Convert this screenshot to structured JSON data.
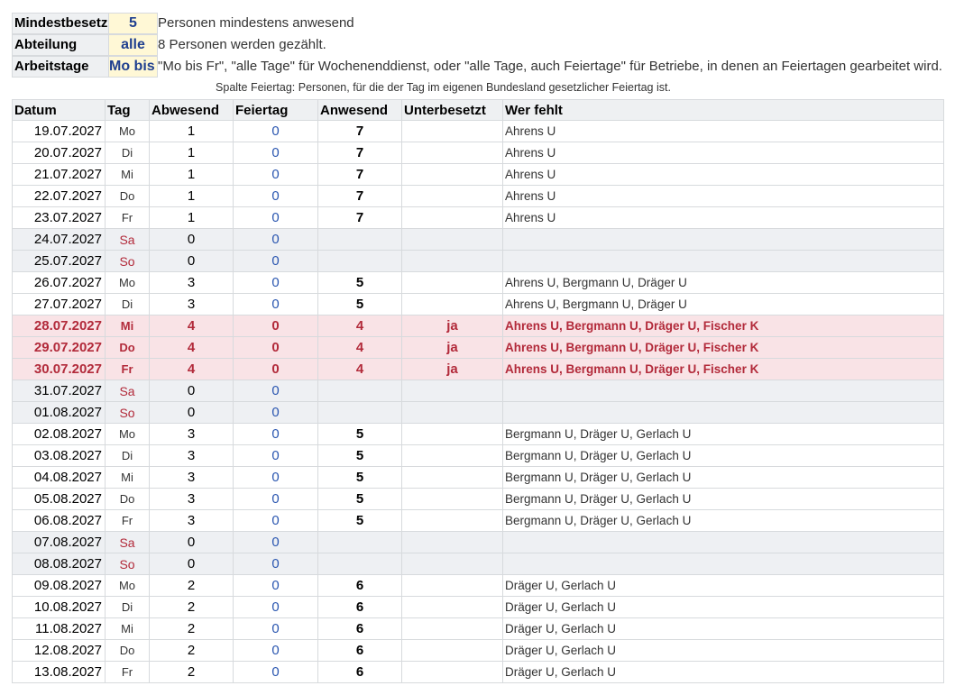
{
  "settings": [
    {
      "label": "Mindestbesetzung",
      "value": "5",
      "description": "Personen mindestens anwesend"
    },
    {
      "label": "Abteilung",
      "value": "alle",
      "description": "8 Personen werden gezählt."
    },
    {
      "label": "Arbeitstage",
      "value": "Mo bis Fr",
      "description": "\"Mo bis Fr\", \"alle Tage\" für Wochenenddienst, oder \"alle Tage, auch Feiertage\" für Betriebe, in denen an Feiertagen gearbeitet wird."
    }
  ],
  "note": "Spalte Feiertag: Personen, für die der Tag im eigenen Bundesland gesetzlicher Feiertag ist.",
  "columns": [
    "Datum",
    "Tag",
    "Abwesend",
    "Feiertag",
    "Anwesend",
    "Unterbesetzt",
    "Wer fehlt"
  ],
  "rows": [
    {
      "datum": "19.07.2027",
      "tag": "Mo",
      "abwesend": "1",
      "feiertag": "0",
      "anwesend": "7",
      "unterbesetzt": "",
      "wer_fehlt": "Ahrens U",
      "status": "normal"
    },
    {
      "datum": "20.07.2027",
      "tag": "Di",
      "abwesend": "1",
      "feiertag": "0",
      "anwesend": "7",
      "unterbesetzt": "",
      "wer_fehlt": "Ahrens U",
      "status": "normal"
    },
    {
      "datum": "21.07.2027",
      "tag": "Mi",
      "abwesend": "1",
      "feiertag": "0",
      "anwesend": "7",
      "unterbesetzt": "",
      "wer_fehlt": "Ahrens U",
      "status": "normal"
    },
    {
      "datum": "22.07.2027",
      "tag": "Do",
      "abwesend": "1",
      "feiertag": "0",
      "anwesend": "7",
      "unterbesetzt": "",
      "wer_fehlt": "Ahrens U",
      "status": "normal"
    },
    {
      "datum": "23.07.2027",
      "tag": "Fr",
      "abwesend": "1",
      "feiertag": "0",
      "anwesend": "7",
      "unterbesetzt": "",
      "wer_fehlt": "Ahrens U",
      "status": "normal"
    },
    {
      "datum": "24.07.2027",
      "tag": "Sa",
      "abwesend": "0",
      "feiertag": "0",
      "anwesend": "",
      "unterbesetzt": "",
      "wer_fehlt": "",
      "status": "weekend"
    },
    {
      "datum": "25.07.2027",
      "tag": "So",
      "abwesend": "0",
      "feiertag": "0",
      "anwesend": "",
      "unterbesetzt": "",
      "wer_fehlt": "",
      "status": "weekend"
    },
    {
      "datum": "26.07.2027",
      "tag": "Mo",
      "abwesend": "3",
      "feiertag": "0",
      "anwesend": "5",
      "unterbesetzt": "",
      "wer_fehlt": "Ahrens U, Bergmann U, Dräger U",
      "status": "normal"
    },
    {
      "datum": "27.07.2027",
      "tag": "Di",
      "abwesend": "3",
      "feiertag": "0",
      "anwesend": "5",
      "unterbesetzt": "",
      "wer_fehlt": "Ahrens U, Bergmann U, Dräger U",
      "status": "normal"
    },
    {
      "datum": "28.07.2027",
      "tag": "Mi",
      "abwesend": "4",
      "feiertag": "0",
      "anwesend": "4",
      "unterbesetzt": "ja",
      "wer_fehlt": "Ahrens U, Bergmann U, Dräger U, Fischer K",
      "status": "under"
    },
    {
      "datum": "29.07.2027",
      "tag": "Do",
      "abwesend": "4",
      "feiertag": "0",
      "anwesend": "4",
      "unterbesetzt": "ja",
      "wer_fehlt": "Ahrens U, Bergmann U, Dräger U, Fischer K",
      "status": "under"
    },
    {
      "datum": "30.07.2027",
      "tag": "Fr",
      "abwesend": "4",
      "feiertag": "0",
      "anwesend": "4",
      "unterbesetzt": "ja",
      "wer_fehlt": "Ahrens U, Bergmann U, Dräger U, Fischer K",
      "status": "under"
    },
    {
      "datum": "31.07.2027",
      "tag": "Sa",
      "abwesend": "0",
      "feiertag": "0",
      "anwesend": "",
      "unterbesetzt": "",
      "wer_fehlt": "",
      "status": "weekend"
    },
    {
      "datum": "01.08.2027",
      "tag": "So",
      "abwesend": "0",
      "feiertag": "0",
      "anwesend": "",
      "unterbesetzt": "",
      "wer_fehlt": "",
      "status": "weekend"
    },
    {
      "datum": "02.08.2027",
      "tag": "Mo",
      "abwesend": "3",
      "feiertag": "0",
      "anwesend": "5",
      "unterbesetzt": "",
      "wer_fehlt": "Bergmann U, Dräger U, Gerlach U",
      "status": "normal"
    },
    {
      "datum": "03.08.2027",
      "tag": "Di",
      "abwesend": "3",
      "feiertag": "0",
      "anwesend": "5",
      "unterbesetzt": "",
      "wer_fehlt": "Bergmann U, Dräger U, Gerlach U",
      "status": "normal"
    },
    {
      "datum": "04.08.2027",
      "tag": "Mi",
      "abwesend": "3",
      "feiertag": "0",
      "anwesend": "5",
      "unterbesetzt": "",
      "wer_fehlt": "Bergmann U, Dräger U, Gerlach U",
      "status": "normal"
    },
    {
      "datum": "05.08.2027",
      "tag": "Do",
      "abwesend": "3",
      "feiertag": "0",
      "anwesend": "5",
      "unterbesetzt": "",
      "wer_fehlt": "Bergmann U, Dräger U, Gerlach U",
      "status": "normal"
    },
    {
      "datum": "06.08.2027",
      "tag": "Fr",
      "abwesend": "3",
      "feiertag": "0",
      "anwesend": "5",
      "unterbesetzt": "",
      "wer_fehlt": "Bergmann U, Dräger U, Gerlach U",
      "status": "normal"
    },
    {
      "datum": "07.08.2027",
      "tag": "Sa",
      "abwesend": "0",
      "feiertag": "0",
      "anwesend": "",
      "unterbesetzt": "",
      "wer_fehlt": "",
      "status": "weekend"
    },
    {
      "datum": "08.08.2027",
      "tag": "So",
      "abwesend": "0",
      "feiertag": "0",
      "anwesend": "",
      "unterbesetzt": "",
      "wer_fehlt": "",
      "status": "weekend"
    },
    {
      "datum": "09.08.2027",
      "tag": "Mo",
      "abwesend": "2",
      "feiertag": "0",
      "anwesend": "6",
      "unterbesetzt": "",
      "wer_fehlt": "Dräger U, Gerlach U",
      "status": "normal"
    },
    {
      "datum": "10.08.2027",
      "tag": "Di",
      "abwesend": "2",
      "feiertag": "0",
      "anwesend": "6",
      "unterbesetzt": "",
      "wer_fehlt": "Dräger U, Gerlach U",
      "status": "normal"
    },
    {
      "datum": "11.08.2027",
      "tag": "Mi",
      "abwesend": "2",
      "feiertag": "0",
      "anwesend": "6",
      "unterbesetzt": "",
      "wer_fehlt": "Dräger U, Gerlach U",
      "status": "normal"
    },
    {
      "datum": "12.08.2027",
      "tag": "Do",
      "abwesend": "2",
      "feiertag": "0",
      "anwesend": "6",
      "unterbesetzt": "",
      "wer_fehlt": "Dräger U, Gerlach U",
      "status": "normal"
    },
    {
      "datum": "13.08.2027",
      "tag": "Fr",
      "abwesend": "2",
      "feiertag": "0",
      "anwesend": "6",
      "unterbesetzt": "",
      "wer_fehlt": "Dräger U, Gerlach U",
      "status": "normal"
    }
  ]
}
